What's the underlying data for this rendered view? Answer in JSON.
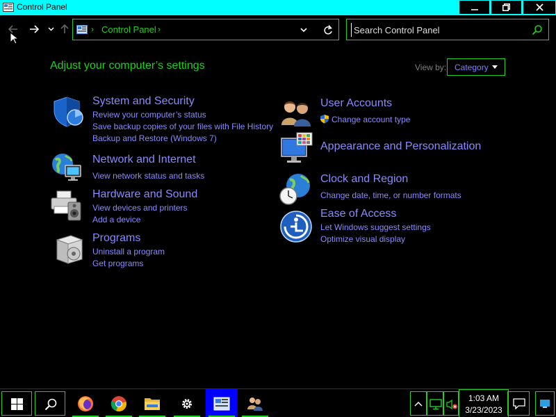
{
  "window": {
    "title": "Control Panel",
    "controls": {
      "minimize": "minimize",
      "maximize": "restore",
      "close": "close"
    }
  },
  "nav": {
    "back_icon": "back-arrow-icon",
    "forward_icon": "forward-arrow-icon",
    "recent_icon": "chevron-down-icon",
    "up_icon": "up-arrow-icon"
  },
  "address": {
    "separator": "›",
    "crumb": "Control Panel",
    "separator2": "›"
  },
  "search": {
    "placeholder": "Search Control Panel"
  },
  "main": {
    "heading": "Adjust your computer’s settings",
    "view_by_label": "View by:",
    "view_by_value": "Category"
  },
  "categories": {
    "system": {
      "title": "System and Security",
      "links": [
        "Review your computer’s status",
        "Save backup copies of your files with File History",
        "Backup and Restore (Windows 7)"
      ]
    },
    "network": {
      "title": "Network and Internet",
      "links": [
        "View network status and tasks"
      ]
    },
    "hardware": {
      "title": "Hardware and Sound",
      "links": [
        "View devices and printers",
        "Add a device"
      ]
    },
    "programs": {
      "title": "Programs",
      "links": [
        "Uninstall a program",
        "Get programs"
      ]
    },
    "users": {
      "title": "User Accounts",
      "links": [
        "Change account type"
      ]
    },
    "appearance": {
      "title": "Appearance and Personalization",
      "links": []
    },
    "clock": {
      "title": "Clock and Region",
      "links": [
        "Change date, time, or number formats"
      ]
    },
    "ease": {
      "title": "Ease of Access",
      "links": [
        "Let Windows suggest settings",
        "Optimize visual display"
      ]
    }
  },
  "taskbar": {
    "items": [
      "start",
      "search",
      "firefox",
      "chrome",
      "file-explorer",
      "settings",
      "control-panel",
      "user-accounts"
    ],
    "time": "1:03 AM",
    "date": "3/23/2023"
  },
  "colors": {
    "accent_green": "#1fd11f",
    "link": "#8a8aff",
    "titlebar": "#00ffff",
    "active_task": "#0000ff"
  }
}
